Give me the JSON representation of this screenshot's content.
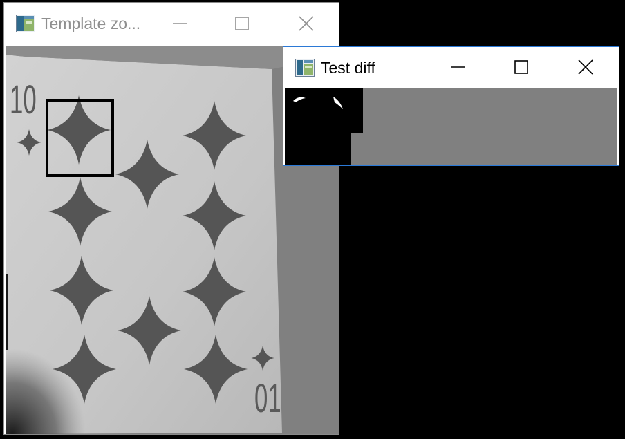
{
  "windows": [
    {
      "title": "Template zo...",
      "state": "inactive",
      "icon": "app-window-icon",
      "controls": [
        "minimize-icon",
        "maximize-icon",
        "close-icon"
      ]
    },
    {
      "title": "Test diff",
      "state": "active",
      "icon": "app-window-icon",
      "controls": [
        "minimize-icon",
        "maximize-icon",
        "close-icon"
      ]
    }
  ],
  "colors": {
    "desktop": "#000000",
    "window_bg": "#ffffff",
    "canvas_bg": "#808080",
    "active_border": "#2b79d6",
    "inactive_title": "#8f8f8f",
    "card_bg": "#c9c9c9",
    "diamond": "#555555"
  },
  "template_zoom": {
    "card": {
      "rank_top": "10",
      "rank_bottom": "01",
      "suit": "diamonds",
      "pips": 10
    },
    "selection": "template-box"
  }
}
